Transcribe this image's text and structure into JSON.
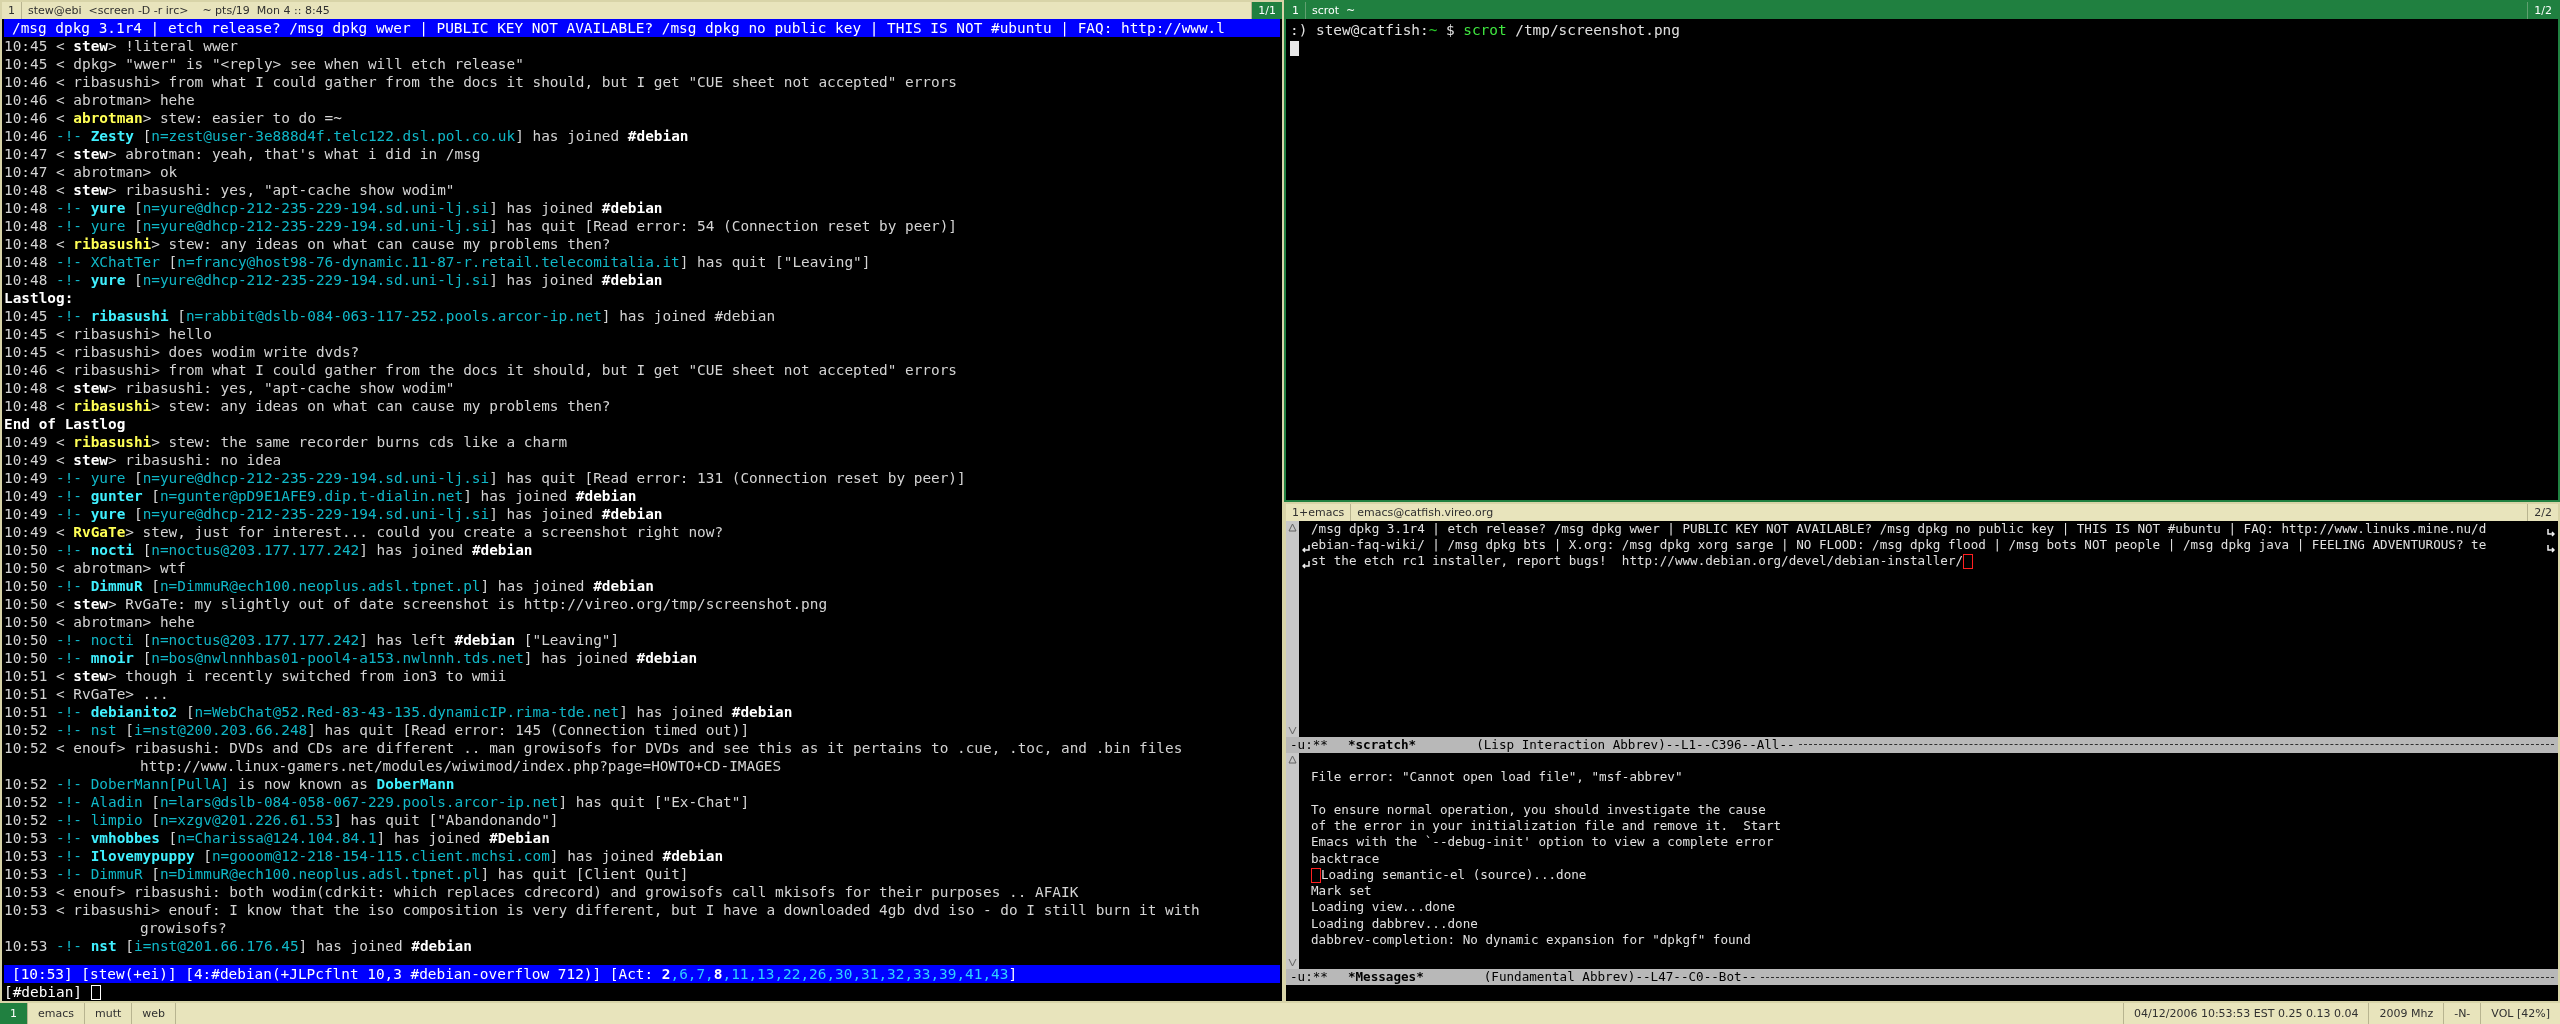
{
  "irc_window": {
    "title_bar": {
      "number": "1",
      "title": "stew@ebi  <screen -D -r irc>    ~ pts/19  Mon 4 :: 8:45",
      "page": "1/1",
      "focused": false,
      "page_highlighted": true
    },
    "topic": "/msg dpkg 3.1r4 | etch release? /msg dpkg wwer | PUBLIC KEY NOT AVAILABLE? /msg dpkg no public key | THIS IS NOT #ubuntu | FAQ: http://www.l",
    "lines": [
      {
        "segments": [
          {
            "text": "10:45 < "
          },
          {
            "text": "stew",
            "kind": "own_nick"
          },
          {
            "text": "> !literal wwer"
          }
        ]
      },
      {
        "segments": [
          {
            "text": "10:45 < dpkg> \"wwer\" is \"<reply> see when will etch release\""
          }
        ]
      },
      {
        "segments": [
          {
            "text": "10:46 < ribasushi> from what I could gather from the docs it should, but I get \"CUE sheet not accepted\" errors"
          }
        ]
      },
      {
        "segments": [
          {
            "text": "10:46 < abrotman> hehe"
          }
        ]
      },
      {
        "segments": [
          {
            "text": "10:46 < "
          },
          {
            "text": "abrotman",
            "kind": "highlighted_nick"
          },
          {
            "text": "> stew: easier to do =~"
          }
        ]
      },
      {
        "segments": [
          {
            "text": "10:46 "
          },
          {
            "text": "-!- ",
            "kind": "event"
          },
          {
            "text": "Zesty",
            "kind": "event_nick"
          },
          {
            "text": " ["
          },
          {
            "text": "n=zest@user-3e888d4f.telc122.dsl.pol.co.uk",
            "kind": "host"
          },
          {
            "text": "] has joined "
          },
          {
            "text": "#debian",
            "kind": "channel"
          }
        ]
      },
      {
        "segments": [
          {
            "text": "10:47 < "
          },
          {
            "text": "stew",
            "kind": "own_nick"
          },
          {
            "text": "> abrotman: yeah, that's what i did in /msg"
          }
        ]
      },
      {
        "segments": [
          {
            "text": "10:47 < abrotman> ok"
          }
        ]
      },
      {
        "segments": [
          {
            "text": "10:48 < "
          },
          {
            "text": "stew",
            "kind": "own_nick"
          },
          {
            "text": "> ribasushi: yes, \"apt-cache show wodim\""
          }
        ]
      },
      {
        "segments": [
          {
            "text": "10:48 "
          },
          {
            "text": "-!- ",
            "kind": "event"
          },
          {
            "text": "yure",
            "kind": "event_nick"
          },
          {
            "text": " ["
          },
          {
            "text": "n=yure@dhcp-212-235-229-194.sd.uni-lj.si",
            "kind": "host"
          },
          {
            "text": "] has joined "
          },
          {
            "text": "#debian",
            "kind": "channel"
          }
        ]
      },
      {
        "segments": [
          {
            "text": "10:48 "
          },
          {
            "text": "-!- yure",
            "kind": "event"
          },
          {
            "text": " ["
          },
          {
            "text": "n=yure@dhcp-212-235-229-194.sd.uni-lj.si",
            "kind": "host"
          },
          {
            "text": "] has quit [Read error: 54 (Connection reset by peer)]"
          }
        ]
      },
      {
        "segments": [
          {
            "text": "10:48 < "
          },
          {
            "text": "ribasushi",
            "kind": "highlighted_nick"
          },
          {
            "text": "> stew: any ideas on what can cause my problems then?"
          }
        ]
      },
      {
        "segments": [
          {
            "text": "10:48 "
          },
          {
            "text": "-!- XChatTer",
            "kind": "event"
          },
          {
            "text": " ["
          },
          {
            "text": "n=francy@host98-76-dynamic.11-87-r.retail.telecomitalia.it",
            "kind": "host"
          },
          {
            "text": "] has quit [\"Leaving\"]"
          }
        ]
      },
      {
        "segments": [
          {
            "text": "10:48 "
          },
          {
            "text": "-!- ",
            "kind": "event"
          },
          {
            "text": "yure",
            "kind": "event_nick"
          },
          {
            "text": " ["
          },
          {
            "text": "n=yure@dhcp-212-235-229-194.sd.uni-lj.si",
            "kind": "host"
          },
          {
            "text": "] has joined "
          },
          {
            "text": "#debian",
            "kind": "channel"
          }
        ]
      },
      {
        "segments": [
          {
            "text": "Lastlog:",
            "kind": "header"
          }
        ]
      },
      {
        "segments": [
          {
            "text": "10:45 "
          },
          {
            "text": "-!- ",
            "kind": "event"
          },
          {
            "text": "ribasushi",
            "kind": "event_nick"
          },
          {
            "text": " ["
          },
          {
            "text": "n=rabbit@dslb-084-063-117-252.pools.arcor-ip.net",
            "kind": "host"
          },
          {
            "text": "] has joined #debian"
          }
        ]
      },
      {
        "segments": [
          {
            "text": "10:45 < ribasushi> hello"
          }
        ]
      },
      {
        "segments": [
          {
            "text": "10:45 < ribasushi> does wodim write dvds?"
          }
        ]
      },
      {
        "segments": [
          {
            "text": "10:46 < ribasushi> from what I could gather from the docs it should, but I get \"CUE sheet not accepted\" errors"
          }
        ]
      },
      {
        "segments": [
          {
            "text": "10:48 < "
          },
          {
            "text": "stew",
            "kind": "own_nick"
          },
          {
            "text": "> ribasushi: yes, \"apt-cache show wodim\""
          }
        ]
      },
      {
        "segments": [
          {
            "text": "10:48 < "
          },
          {
            "text": "ribasushi",
            "kind": "highlighted_nick"
          },
          {
            "text": "> stew: any ideas on what can cause my problems then?"
          }
        ]
      },
      {
        "segments": [
          {
            "text": "End of Lastlog",
            "kind": "header"
          }
        ]
      },
      {
        "segments": [
          {
            "text": "10:49 < "
          },
          {
            "text": "ribasushi",
            "kind": "highlighted_nick"
          },
          {
            "text": "> stew: the same recorder burns cds like a charm"
          }
        ]
      },
      {
        "segments": [
          {
            "text": "10:49 < "
          },
          {
            "text": "stew",
            "kind": "own_nick"
          },
          {
            "text": "> ribasushi: no idea"
          }
        ]
      },
      {
        "segments": [
          {
            "text": "10:49 "
          },
          {
            "text": "-!- yure",
            "kind": "event"
          },
          {
            "text": " ["
          },
          {
            "text": "n=yure@dhcp-212-235-229-194.sd.uni-lj.si",
            "kind": "host"
          },
          {
            "text": "] has quit [Read error: 131 (Connection reset by peer)]"
          }
        ]
      },
      {
        "segments": [
          {
            "text": "10:49 "
          },
          {
            "text": "-!- ",
            "kind": "event"
          },
          {
            "text": "gunter",
            "kind": "event_nick"
          },
          {
            "text": " ["
          },
          {
            "text": "n=gunter@pD9E1AFE9.dip.t-dialin.net",
            "kind": "host"
          },
          {
            "text": "] has joined "
          },
          {
            "text": "#debian",
            "kind": "channel"
          }
        ]
      },
      {
        "segments": [
          {
            "text": "10:49 "
          },
          {
            "text": "-!- ",
            "kind": "event"
          },
          {
            "text": "yure",
            "kind": "event_nick"
          },
          {
            "text": " ["
          },
          {
            "text": "n=yure@dhcp-212-235-229-194.sd.uni-lj.si",
            "kind": "host"
          },
          {
            "text": "] has joined "
          },
          {
            "text": "#debian",
            "kind": "channel"
          }
        ]
      },
      {
        "segments": [
          {
            "text": "10:49 < "
          },
          {
            "text": "RvGaTe",
            "kind": "highlighted_nick"
          },
          {
            "text": "> stew, just for interest... could you create a screenshot right now?"
          }
        ]
      },
      {
        "segments": [
          {
            "text": "10:50 "
          },
          {
            "text": "-!- ",
            "kind": "event"
          },
          {
            "text": "nocti",
            "kind": "event_nick"
          },
          {
            "text": " ["
          },
          {
            "text": "n=noctus@203.177.177.242",
            "kind": "host"
          },
          {
            "text": "] has joined "
          },
          {
            "text": "#debian",
            "kind": "channel"
          }
        ]
      },
      {
        "segments": [
          {
            "text": "10:50 < abrotman> wtf"
          }
        ]
      },
      {
        "segments": [
          {
            "text": "10:50 "
          },
          {
            "text": "-!- ",
            "kind": "event"
          },
          {
            "text": "DimmuR",
            "kind": "event_nick"
          },
          {
            "text": " ["
          },
          {
            "text": "n=DimmuR@ech100.neoplus.adsl.tpnet.pl",
            "kind": "host"
          },
          {
            "text": "] has joined "
          },
          {
            "text": "#debian",
            "kind": "channel"
          }
        ]
      },
      {
        "segments": [
          {
            "text": "10:50 < "
          },
          {
            "text": "stew",
            "kind": "own_nick"
          },
          {
            "text": "> RvGaTe: my slightly out of date screenshot is http://vireo.org/tmp/screenshot.png"
          }
        ]
      },
      {
        "segments": [
          {
            "text": "10:50 < abrotman> hehe"
          }
        ]
      },
      {
        "segments": [
          {
            "text": "10:50 "
          },
          {
            "text": "-!- nocti",
            "kind": "event"
          },
          {
            "text": " ["
          },
          {
            "text": "n=noctus@203.177.177.242",
            "kind": "host"
          },
          {
            "text": "] has left "
          },
          {
            "text": "#debian",
            "kind": "channel"
          },
          {
            "text": " [\"Leaving\"]"
          }
        ]
      },
      {
        "segments": [
          {
            "text": "10:50 "
          },
          {
            "text": "-!- ",
            "kind": "event"
          },
          {
            "text": "mnoir",
            "kind": "event_nick"
          },
          {
            "text": " ["
          },
          {
            "text": "n=bos@nwlnnhbas01-pool4-a153.nwlnnh.tds.net",
            "kind": "host"
          },
          {
            "text": "] has joined "
          },
          {
            "text": "#debian",
            "kind": "channel"
          }
        ]
      },
      {
        "segments": [
          {
            "text": "10:51 < "
          },
          {
            "text": "stew",
            "kind": "own_nick"
          },
          {
            "text": "> though i recently switched from ion3 to wmii"
          }
        ]
      },
      {
        "segments": [
          {
            "text": "10:51 < RvGaTe> ..."
          }
        ]
      },
      {
        "segments": [
          {
            "text": "10:51 "
          },
          {
            "text": "-!- ",
            "kind": "event"
          },
          {
            "text": "debianito2",
            "kind": "event_nick"
          },
          {
            "text": " ["
          },
          {
            "text": "n=WebChat@52.Red-83-43-135.dynamicIP.rima-tde.net",
            "kind": "host"
          },
          {
            "text": "] has joined "
          },
          {
            "text": "#debian",
            "kind": "channel"
          }
        ]
      },
      {
        "segments": [
          {
            "text": "10:52 "
          },
          {
            "text": "-!- nst",
            "kind": "event"
          },
          {
            "text": " ["
          },
          {
            "text": "i=nst@200.203.66.248",
            "kind": "host"
          },
          {
            "text": "] has quit [Read error: 145 (Connection timed out)]"
          }
        ]
      },
      {
        "segments": [
          {
            "text": "10:52 < enouf> ribasushi: DVDs and CDs are different .. man growisofs for DVDs and see this as it pertains to .cue, .toc, and .bin files"
          }
        ]
      },
      {
        "indented": true,
        "segments": [
          {
            "text": "http://www.linux-gamers.net/modules/wiwimod/index.php?page=HOWTO+CD-IMAGES"
          }
        ]
      },
      {
        "segments": [
          {
            "text": "10:52 "
          },
          {
            "text": "-!- DoberMann[PullA]",
            "kind": "event"
          },
          {
            "text": " is now known as "
          },
          {
            "text": "DoberMann",
            "kind": "event_nick"
          }
        ]
      },
      {
        "segments": [
          {
            "text": "10:52 "
          },
          {
            "text": "-!- Aladin",
            "kind": "event"
          },
          {
            "text": " ["
          },
          {
            "text": "n=lars@dslb-084-058-067-229.pools.arcor-ip.net",
            "kind": "host"
          },
          {
            "text": "] has quit [\"Ex-Chat\"]"
          }
        ]
      },
      {
        "segments": [
          {
            "text": "10:52 "
          },
          {
            "text": "-!- limpio",
            "kind": "event"
          },
          {
            "text": " ["
          },
          {
            "text": "n=xzgv@201.226.61.53",
            "kind": "host"
          },
          {
            "text": "] has quit [\"Abandonando\"]"
          }
        ]
      },
      {
        "segments": [
          {
            "text": "10:53 "
          },
          {
            "text": "-!- ",
            "kind": "event"
          },
          {
            "text": "vmhobbes",
            "kind": "event_nick"
          },
          {
            "text": " ["
          },
          {
            "text": "n=Charissa@124.104.84.1",
            "kind": "host"
          },
          {
            "text": "] has joined "
          },
          {
            "text": "#Debian",
            "kind": "channel"
          }
        ]
      },
      {
        "segments": [
          {
            "text": "10:53 "
          },
          {
            "text": "-!- ",
            "kind": "event"
          },
          {
            "text": "Ilovemypuppy",
            "kind": "event_nick"
          },
          {
            "text": " ["
          },
          {
            "text": "n=gooom@12-218-154-115.client.mchsi.com",
            "kind": "host"
          },
          {
            "text": "] has joined "
          },
          {
            "text": "#debian",
            "kind": "channel"
          }
        ]
      },
      {
        "segments": [
          {
            "text": "10:53 "
          },
          {
            "text": "-!- DimmuR",
            "kind": "event"
          },
          {
            "text": " ["
          },
          {
            "text": "n=DimmuR@ech100.neoplus.adsl.tpnet.pl",
            "kind": "host"
          },
          {
            "text": "] has quit [Client Quit]"
          }
        ]
      },
      {
        "segments": [
          {
            "text": "10:53 < enouf> ribasushi: both wodim(cdrkit: which replaces cdrecord) and growisofs call mkisofs for their purposes .. AFAIK"
          }
        ]
      },
      {
        "segments": [
          {
            "text": "10:53 < ribasushi> enouf: I know that the iso composition is very different, but I have a downloaded 4gb dvd iso - do I still burn it with"
          }
        ]
      },
      {
        "indented": true,
        "segments": [
          {
            "text": "growisofs?"
          }
        ]
      },
      {
        "segments": [
          {
            "text": "10:53 "
          },
          {
            "text": "-!- ",
            "kind": "event"
          },
          {
            "text": "nst",
            "kind": "event_nick"
          },
          {
            "text": " ["
          },
          {
            "text": "i=nst@201.66.176.45",
            "kind": "host"
          },
          {
            "text": "] has joined "
          },
          {
            "text": "#debian",
            "kind": "channel"
          }
        ]
      }
    ],
    "status_line": [
      {
        "text": "[10:53] [stew(+ei)] [4:#debian(+JLPcflnt 10,3 #debian-overflow 712)] [Act: "
      },
      {
        "text": "2",
        "kind": "hilight"
      },
      {
        "text": ",6,7,",
        "kind": "activity"
      },
      {
        "text": "8",
        "kind": "hilight"
      },
      {
        "text": ",11,13,22,26,30,31,32,33,39,41,43",
        "kind": "activity"
      },
      {
        "text": "]"
      }
    ],
    "input_prompt": "[#debian]"
  },
  "terminal_window": {
    "title_bar": {
      "number": "1",
      "title": "scrot  ~",
      "page": "1/2",
      "focused": true,
      "page_highlighted": true
    },
    "prompt": [
      {
        "text": ":) stew@catfish:"
      },
      {
        "text": "~",
        "kind": "path"
      },
      {
        "text": " $ "
      },
      {
        "text": "scrot",
        "kind": "command"
      },
      {
        "text": " /tmp/screenshot.png"
      }
    ]
  },
  "emacs_window": {
    "title_bar": {
      "number": "1+emacs",
      "title": "emacs@catfish.vireo.org",
      "page": "2/2",
      "focused": false,
      "page_highlighted": false
    },
    "upper_buffer": {
      "lines": [
        {
          "text": "/msg dpkg 3.1r4 | etch release? /msg dpkg wwer | PUBLIC KEY NOT AVAILABLE? /msg dpkg no public key | THIS IS NOT #ubuntu | FAQ: http://www.linuks.mine.nu/d",
          "continued": false,
          "wrapped": true,
          "cursor_after": false
        },
        {
          "text": "ebian-faq-wiki/ | /msg dpkg bts | X.org: /msg dpkg xorg sarge | NO FLOOD: /msg dpkg flood | /msg bots NOT people | /msg dpkg java | FEELING ADVENTUROUS? te",
          "continued": true,
          "wrapped": true,
          "cursor_after": false
        },
        {
          "text": "st the etch rc1 installer, report bugs!  http://www.debian.org/devel/debian-installer/",
          "continued": true,
          "wrapped": false,
          "cursor_after": true
        }
      ],
      "mode_line": {
        "status": "-u:**",
        "buffer": "*scratch*",
        "mode": "(Lisp Interaction Abbrev)--L1--C396--All--"
      }
    },
    "lower_buffer": {
      "lines": [
        {
          "text": "File error: \"Cannot open load file\", \"msf-abbrev\"",
          "blank_before": true,
          "cursor_before": false
        },
        {
          "text": "To ensure normal operation, you should investigate the cause",
          "blank_before": true,
          "cursor_before": false
        },
        {
          "text": "of the error in your initialization file and remove it.  Start",
          "blank_before": false,
          "cursor_before": false
        },
        {
          "text": "Emacs with the `--debug-init' option to view a complete error",
          "blank_before": false,
          "cursor_before": false
        },
        {
          "text": "backtrace",
          "blank_before": false,
          "cursor_before": false
        },
        {
          "text": "Loading semantic-el (source)...done",
          "blank_before": false,
          "cursor_before": true
        },
        {
          "text": "Mark set",
          "blank_before": false,
          "cursor_before": false
        },
        {
          "text": "Loading view...done",
          "blank_before": false,
          "cursor_before": false
        },
        {
          "text": "Loading dabbrev...done",
          "blank_before": false,
          "cursor_before": false
        },
        {
          "text": "dabbrev-completion: No dynamic expansion for \"dpkgf\" found",
          "blank_before": false,
          "cursor_before": false
        }
      ],
      "mode_line": {
        "status": "-u:**",
        "buffer": "*Messages*",
        "mode": "(Fundamental Abbrev)--L47--C0--Bot--"
      }
    }
  },
  "bar": {
    "tags": [
      {
        "label": "1",
        "selected": true
      },
      {
        "label": "emacs",
        "selected": false
      },
      {
        "label": "mutt",
        "selected": false
      },
      {
        "label": "web",
        "selected": false
      }
    ],
    "status": [
      "04/12/2006 10:53:53 EST 0.25 0.13 0.04",
      "2009 Mhz",
      "-N-",
      "VOL [42%]"
    ]
  }
}
